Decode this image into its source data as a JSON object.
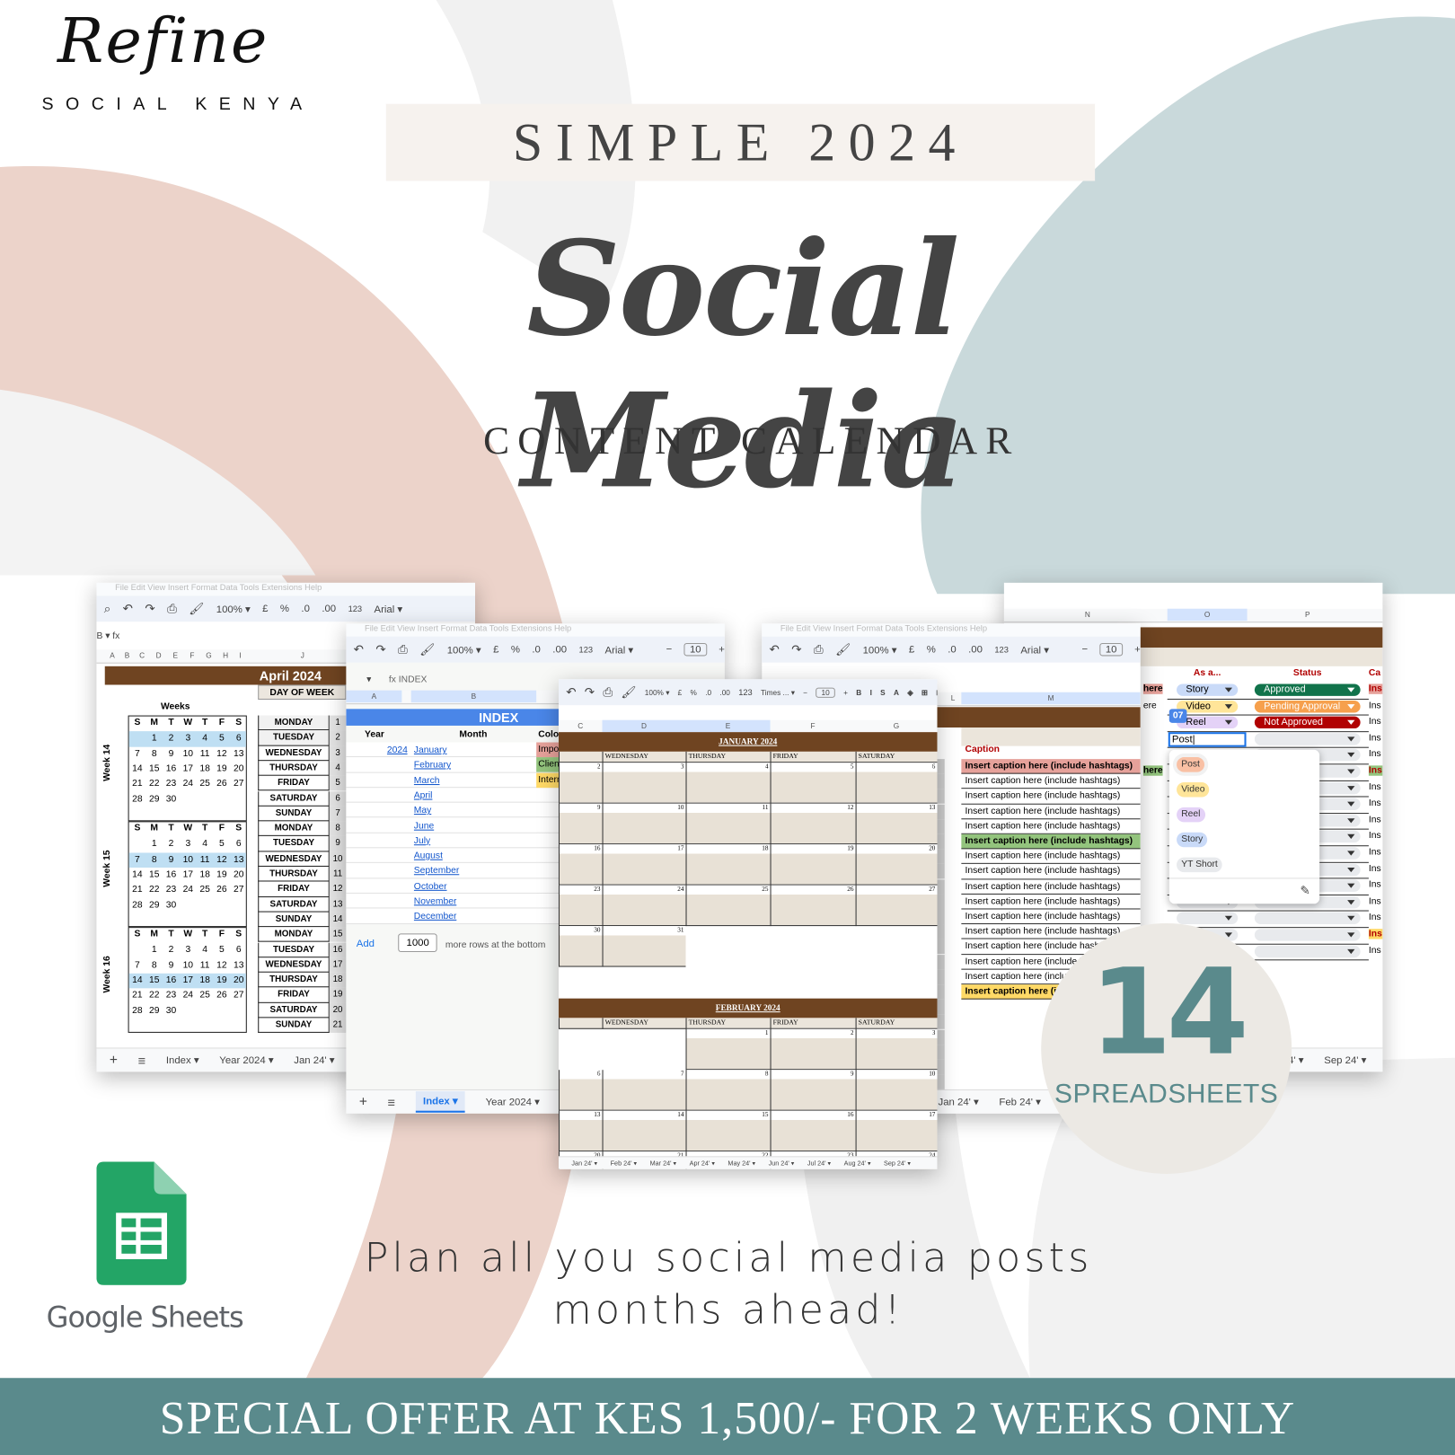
{
  "brand": {
    "logo_script": "Refine",
    "logo_sub": "SOCIAL KENYA"
  },
  "hero": {
    "tag": "SIMPLE 2024",
    "title": "Social Media",
    "subtitle": "CONTENT CALENDAR"
  },
  "colors": {
    "brown": "#6f4421",
    "teal": "#5a8a8c",
    "index_blue": "#4a86e8",
    "pink_bg": "#ecd3ca",
    "blue_gray_bg": "#c9d9db"
  },
  "toolbar": {
    "zoom": "100%",
    "currency": "£",
    "percent": "%",
    "dec_less": ".0",
    "dec_more": ".00",
    "format": "123",
    "font": "Arial",
    "font_times": "Times ...",
    "font_size": "10"
  },
  "menu_items": [
    "File",
    "Edit",
    "View",
    "Insert",
    "Format",
    "Data",
    "Tools",
    "Extensions",
    "Help"
  ],
  "sheet_april": {
    "cols": [
      "A",
      "B",
      "C",
      "D",
      "E",
      "F",
      "G",
      "H",
      "I",
      "J",
      "K"
    ],
    "title": "April 2024",
    "day_of_week_header": "DAY OF WEEK",
    "weeks_label": "Weeks",
    "weekday_letters": [
      "S",
      "M",
      "T",
      "W",
      "T",
      "F",
      "S"
    ],
    "blocks": [
      {
        "label": "Week 14",
        "highlight_row": 0
      },
      {
        "label": "Week 15",
        "highlight_row": 1
      },
      {
        "label": "Week 16",
        "highlight_row": 2
      }
    ],
    "month_rows": [
      [
        "",
        "1",
        "2",
        "3",
        "4",
        "5",
        "6"
      ],
      [
        "7",
        "8",
        "9",
        "10",
        "11",
        "12",
        "13"
      ],
      [
        "14",
        "15",
        "16",
        "17",
        "18",
        "19",
        "20"
      ],
      [
        "21",
        "22",
        "23",
        "24",
        "25",
        "26",
        "27"
      ],
      [
        "28",
        "29",
        "30",
        "",
        "",
        "",
        ""
      ]
    ],
    "days": [
      "MONDAY",
      "TUESDAY",
      "WEDNESDAY",
      "THURSDAY",
      "FRIDAY",
      "SATURDAY",
      "SUNDAY",
      "MONDAY",
      "TUESDAY",
      "WEDNESDAY",
      "THURSDAY",
      "FRIDAY",
      "SATURDAY",
      "SUNDAY",
      "MONDAY",
      "TUESDAY",
      "WEDNESDAY",
      "THURSDAY",
      "FRIDAY",
      "SATURDAY",
      "SUNDAY"
    ],
    "tabs": [
      "Index",
      "Year 2024",
      "Jan 24'"
    ]
  },
  "sheet_index": {
    "formula": "INDEX",
    "cols": [
      "A",
      "B"
    ],
    "title": "INDEX",
    "headers": [
      "Year",
      "Month",
      "Colour"
    ],
    "year": "2024",
    "months": [
      "January",
      "February",
      "March",
      "April",
      "May",
      "June",
      "July",
      "August",
      "September",
      "October",
      "November",
      "December"
    ],
    "legend": [
      {
        "label": "Important",
        "color": "#e6a19a"
      },
      {
        "label": "Client",
        "color": "#93c47d"
      },
      {
        "label": "Internal",
        "color": "#ffd966"
      }
    ],
    "add_label": "Add",
    "add_rows": "1000",
    "add_suffix": "more rows at the bottom",
    "tabs": [
      "Index",
      "Year 2024",
      "Jan 24'"
    ]
  },
  "sheet_calendar": {
    "cols": [
      "C",
      "D",
      "E",
      "F",
      "G"
    ],
    "months": [
      {
        "title": "JANUARY 2024",
        "weekdays": [
          "",
          "WEDNESDAY",
          "THURSDAY",
          "FRIDAY",
          "SATURDAY"
        ],
        "weeks": [
          [
            "2",
            "3",
            "4",
            "5",
            "6"
          ],
          [
            "9",
            "10",
            "11",
            "12",
            "13"
          ],
          [
            "16",
            "17",
            "18",
            "19",
            "20"
          ],
          [
            "23",
            "24",
            "25",
            "26",
            "27"
          ],
          [
            "30",
            "31",
            "",
            "",
            ""
          ]
        ]
      },
      {
        "title": "FEBRUARY 2024",
        "weekdays": [
          "",
          "WEDNESDAY",
          "THURSDAY",
          "FRIDAY",
          "SATURDAY"
        ],
        "weeks": [
          [
            "",
            "",
            "1",
            "2",
            "3"
          ],
          [
            "6",
            "7",
            "8",
            "9",
            "10"
          ],
          [
            "13",
            "14",
            "15",
            "16",
            "17"
          ],
          [
            "20",
            "21",
            "22",
            "23",
            "24"
          ]
        ]
      }
    ],
    "tabs": [
      "Jan 24'",
      "Feb 24'",
      "Mar 24'",
      "Apr 24'",
      "May 24'",
      "Jun 24'",
      "Jul 24'",
      "Aug 24'",
      "Sep 24'"
    ]
  },
  "sheet_captions": {
    "cols": [
      "L",
      "M"
    ],
    "header": "Caption",
    "row_text": "Insert caption here (include hashtags)",
    "highlights": {
      "0": "#e6a19a",
      "5": "#93c47d",
      "15": "#ffd966"
    },
    "row_count": 16,
    "tabs": [
      "Jan 24'",
      "Feb 24'"
    ]
  },
  "sheet_status": {
    "cols": [
      "N",
      "O",
      "P"
    ],
    "headers": {
      "as_a": "As a...",
      "status": "Status",
      "caption_short": "Ca"
    },
    "n_partial": [
      "here",
      "ere",
      "",
      "",
      "",
      "here"
    ],
    "rows": [
      {
        "type": "Story",
        "type_color": "#c9daf8",
        "status": "Approved",
        "status_color": "#11734b"
      },
      {
        "type": "Video",
        "type_color": "#ffe599",
        "status": "Pending Approval",
        "status_color": "#f6a04d"
      },
      {
        "type": "Reel",
        "type_color": "#e4d2f7",
        "status": "Not Approved",
        "status_color": "#b10202"
      }
    ],
    "editing_value": "Post",
    "cursor_badge": "07",
    "ins_text": "Ins",
    "dropdown_options": [
      {
        "label": "Post",
        "color": "#f9c0a4"
      },
      {
        "label": "Video",
        "color": "#ffe599"
      },
      {
        "label": "Reel",
        "color": "#e4d2f7"
      },
      {
        "label": "Story",
        "color": "#c9daf8"
      },
      {
        "label": "YT Short",
        "color": "#e8eaed"
      }
    ],
    "tabs": [
      "Aug 24'",
      "Sep 24'"
    ]
  },
  "badge": {
    "count": "14",
    "label": "SPREADSHEETS"
  },
  "google_sheets": {
    "label": "Google Sheets"
  },
  "tagline": {
    "line1": "Plan all you social media posts",
    "line2": "months ahead!"
  },
  "offer": "SPECIAL OFFER AT KES 1,500/- FOR 2 WEEKS ONLY"
}
